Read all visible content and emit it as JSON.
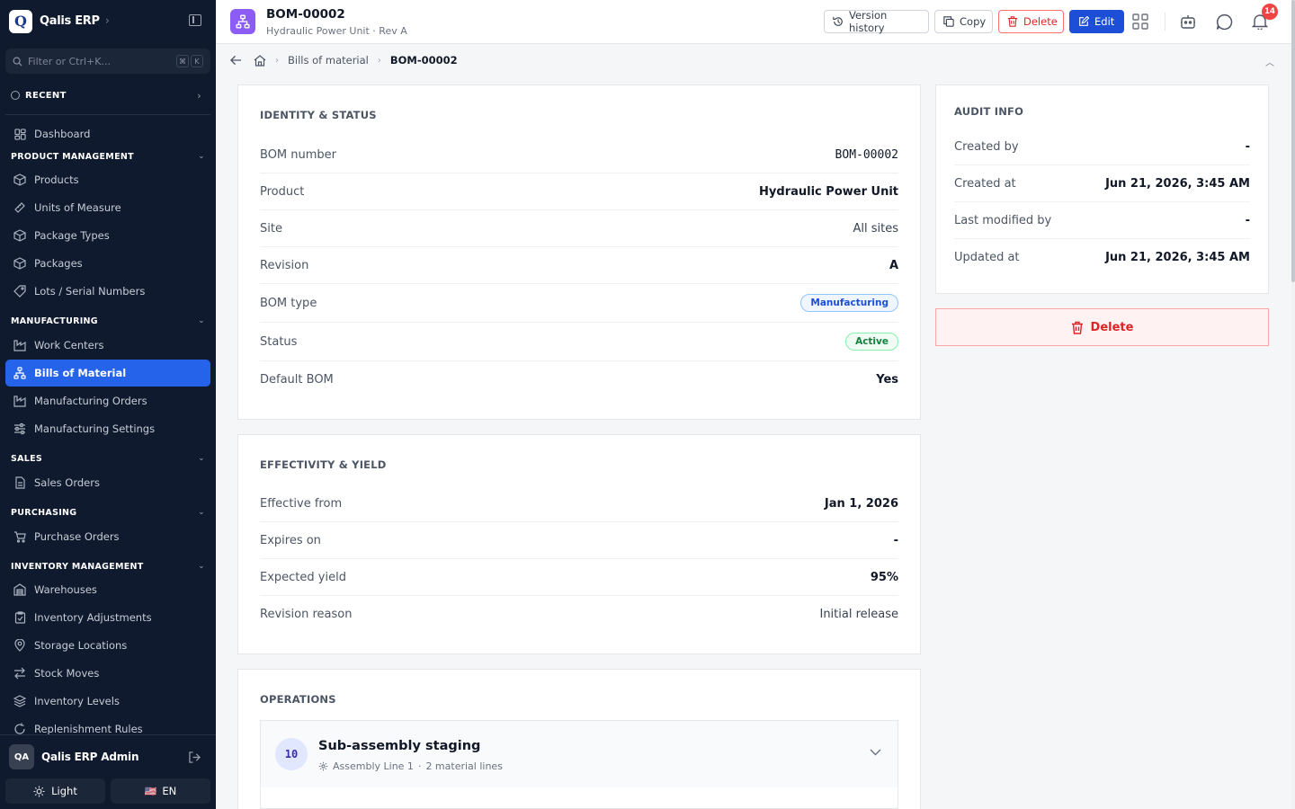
{
  "app": {
    "logo_letter": "Q",
    "name": "Qalis ERP"
  },
  "search": {
    "placeholder": "Filter or Ctrl+K...",
    "kbd1": "⌘",
    "kbd2": "K"
  },
  "sidebar": {
    "recent_label": "RECENT",
    "dashboard": "Dashboard",
    "sections": {
      "product": "PRODUCT MANAGEMENT",
      "manufacturing": "MANUFACTURING",
      "sales": "SALES",
      "purchasing": "PURCHASING",
      "inventory": "INVENTORY MANAGEMENT"
    },
    "items": {
      "products": "Products",
      "uom": "Units of Measure",
      "package_types": "Package Types",
      "packages": "Packages",
      "lots": "Lots / Serial Numbers",
      "work_centers": "Work Centers",
      "boms": "Bills of Material",
      "mos": "Manufacturing Orders",
      "mfg_settings": "Manufacturing Settings",
      "sales_orders": "Sales Orders",
      "purchase_orders": "Purchase Orders",
      "warehouses": "Warehouses",
      "inv_adjust": "Inventory Adjustments",
      "storage": "Storage Locations",
      "stock_moves": "Stock Moves",
      "inv_levels": "Inventory Levels",
      "replenish": "Replenishment Rules"
    },
    "user": {
      "initials": "QA",
      "name": "Qalis ERP Admin"
    },
    "theme_label": "Light",
    "lang_label": "EN",
    "lang_flag": "🇺🇸"
  },
  "header": {
    "title": "BOM-00002",
    "subtitle": "Hydraulic Power Unit · Rev A",
    "version_history": "Version history",
    "copy": "Copy",
    "delete": "Delete",
    "edit": "Edit",
    "notif_count": "14"
  },
  "breadcrumb": {
    "parent": "Bills of material",
    "current": "BOM-00002"
  },
  "identity": {
    "title": "IDENTITY & STATUS",
    "rows": [
      {
        "label": "BOM number",
        "value": "BOM-00002"
      },
      {
        "label": "Product",
        "value": "Hydraulic Power Unit"
      },
      {
        "label": "Site",
        "value": "All sites"
      },
      {
        "label": "Revision",
        "value": "A"
      },
      {
        "label": "BOM type",
        "value": "Manufacturing"
      },
      {
        "label": "Status",
        "value": "Active"
      },
      {
        "label": "Default BOM",
        "value": "Yes"
      }
    ]
  },
  "effectivity": {
    "title": "EFFECTIVITY & YIELD",
    "rows": [
      {
        "label": "Effective from",
        "value": "Jan 1, 2026"
      },
      {
        "label": "Expires on",
        "value": "-"
      },
      {
        "label": "Expected yield",
        "value": "95%"
      },
      {
        "label": "Revision reason",
        "value": "Initial release"
      }
    ]
  },
  "operations": {
    "title": "OPERATIONS",
    "items": [
      {
        "seq": "10",
        "name": "Sub-assembly staging",
        "work_center": "Assembly Line 1",
        "sep": "·",
        "lines": "2 material lines"
      }
    ]
  },
  "audit": {
    "title": "AUDIT INFO",
    "rows": [
      {
        "label": "Created by",
        "value": "-"
      },
      {
        "label": "Created at",
        "value": "Jun 21, 2026, 3:45 AM"
      },
      {
        "label": "Last modified by",
        "value": "-"
      },
      {
        "label": "Updated at",
        "value": "Jun 21, 2026, 3:45 AM"
      }
    ]
  },
  "delete_action": "Delete",
  "colors": {
    "accent": "#2563eb",
    "sidebar_bg": "#0f1a2e",
    "danger": "#dc2626",
    "success": "#15803d",
    "doc_icon": "#8b5cf6"
  }
}
